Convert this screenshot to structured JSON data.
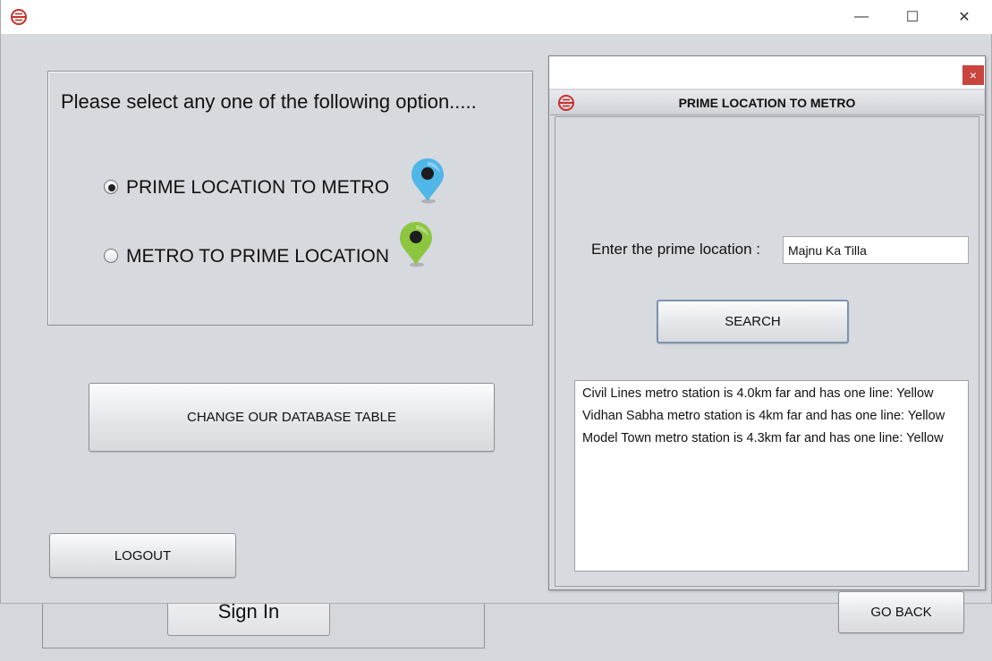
{
  "main": {
    "prompt": "Please select any one of the following option.....",
    "options": [
      {
        "label": "PRIME LOCATION TO METRO",
        "selected": true,
        "pin_color": "#4fb6e8"
      },
      {
        "label": "METRO TO PRIME LOCATION",
        "selected": false,
        "pin_color": "#8cc63f"
      }
    ],
    "change_db_button": "CHANGE OUR DATABASE TABLE",
    "logout_button": "LOGOUT"
  },
  "background_window": {
    "signin_button": "Sign In"
  },
  "window_controls": {
    "minimize": "—",
    "maximize": "☐",
    "close": "✕"
  },
  "dialog": {
    "close": "×",
    "title": "PRIME LOCATION TO METRO",
    "prime_label": "Enter the prime location :",
    "prime_value": "Majnu Ka Tilla",
    "search_button": "SEARCH",
    "results": [
      "Civil Lines metro station is 4.0km far and has one line: Yellow",
      "Vidhan Sabha metro station is 4km far and has one line: Yellow",
      "Model Town metro station is 4.3km far and has one line: Yellow"
    ],
    "go_back_button": "GO BACK"
  },
  "colors": {
    "logo_red": "#c8302a",
    "close_red": "#c9443d"
  }
}
